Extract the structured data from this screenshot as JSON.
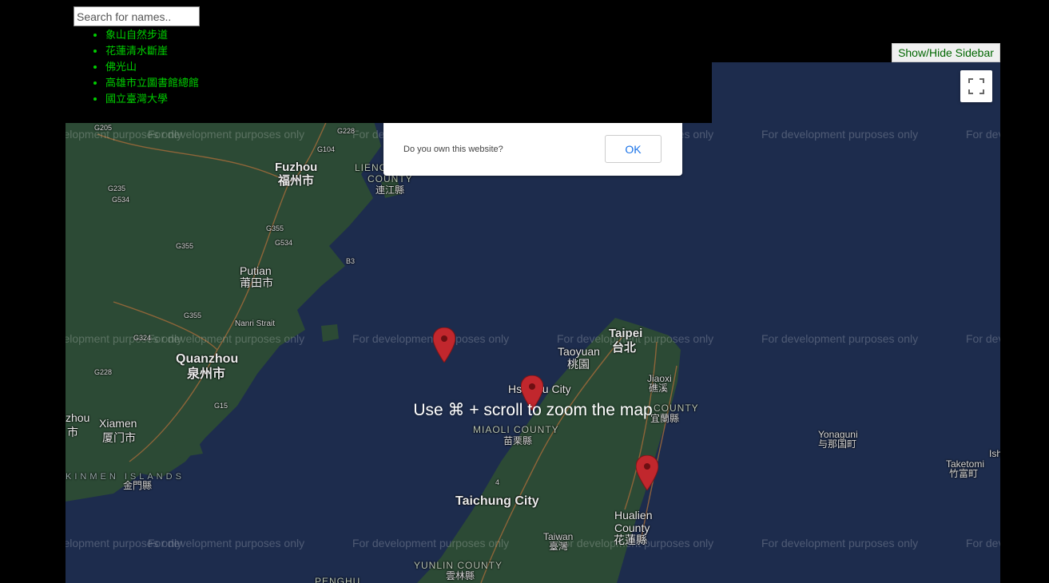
{
  "search": {
    "placeholder": "Search for names.."
  },
  "sidebar": {
    "items": [
      {
        "label": "象山自然步道"
      },
      {
        "label": "花蓮清水斷崖"
      },
      {
        "label": "佛光山"
      },
      {
        "label": "高雄市立圖書館總館"
      },
      {
        "label": "國立臺灣大學"
      }
    ]
  },
  "toggle_button": {
    "label": "Show/Hide Sidebar"
  },
  "map": {
    "watermark": "For development purposes only",
    "dialog": {
      "message": "Do you own this website?",
      "ok_label": "OK"
    },
    "zoom_hint": "Use ⌘ + scroll to zoom the map",
    "fullscreen_icon": "fullscreen-icon",
    "colors": {
      "water": "#1d2c4d",
      "land": "#2c4a35",
      "marker": "#c1272d",
      "list_text": "#00cc00"
    },
    "markers": [
      {
        "name": "marker-1"
      },
      {
        "name": "marker-2"
      },
      {
        "name": "marker-3"
      }
    ],
    "labels": {
      "fuzhou": "Fuzhou",
      "fuzhou_zh": "福州市",
      "lienchiang": "LIENCHIANG",
      "county": "COUNTY",
      "lienchiang_zh": "連江縣",
      "putian": "Putian",
      "putian_zh": "莆田市",
      "quanzhou": "Quanzhou",
      "quanzhou_zh": "泉州市",
      "zhou": "zhou",
      "shi": "市",
      "xiamen": "Xiamen",
      "xiamen_zh": "厦门市",
      "kinmen": "KINMEN ISLANDS",
      "kinmen_zh": "金門縣",
      "taipei": "Taipei",
      "taipei_zh": "台北",
      "taoyuan": "Taoyuan",
      "taoyuan_zh": "桃園",
      "hsinchu": "Hsinchu City",
      "jiaoxi": "Jiaoxi",
      "jiaoxi_zh": "礁溪",
      "yilan_county": "COUNTY",
      "yilan_zh": "宜蘭縣",
      "miaoli": "MIAOLI COUNTY",
      "miaoli_zh": "苗栗縣",
      "taichung": "Taichung City",
      "taiwan": "Taiwan",
      "taiwan_zh": "臺灣",
      "hualien": "Hualien",
      "hualien_county": "County",
      "hualien_zh": "花蓮縣",
      "yunlin": "YUNLIN COUNTY",
      "yunlin_zh": "雲林縣",
      "penghu": "PENGHU",
      "yonaguni": "Yonaguni",
      "yonaguni_zh": "与那国町",
      "taketomi": "Taketomi",
      "taketomi_zh": "竹富町",
      "ish": "Ish",
      "nanri": "Nanri Strait",
      "r_g205": "G205",
      "r_g228": "G228",
      "r_g104": "G104",
      "r_g235": "G235",
      "r_g534": "G534",
      "r_g355": "G355",
      "r_g355b": "G355",
      "r_g534b": "G534",
      "r_b3": "B3",
      "r_g324": "G324",
      "r_g355c": "G355",
      "r_g228b": "G228",
      "r_g15": "G15",
      "r_4": "4"
    }
  }
}
